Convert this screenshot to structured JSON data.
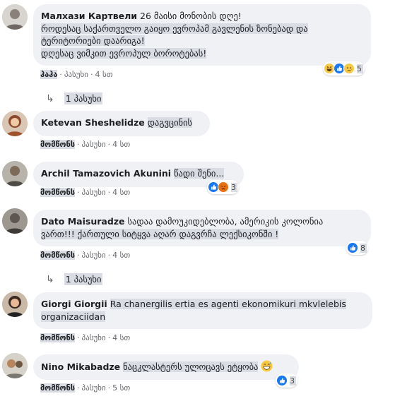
{
  "colors": {
    "bubble": "#eff1f5",
    "highlight": "#d9dde3",
    "like_blue": "#1877f2",
    "haha_yellow": "#f7c940",
    "angry_orange": "#e9710f",
    "meta_gray": "#65676b"
  },
  "comments": [
    {
      "author": "Малхази Картвели",
      "text_lines": [
        "26 მაისი მონობის დღე!",
        "როდესაც საქართველო გაიყო ევროპამ გავლენის ზონებად და",
        "ტერიტორიები დაარიგა!",
        "დღესაც ვიმკით ევროპულ ბოროტებას!"
      ],
      "actions": {
        "like": "ჰაჰა",
        "reply": "პასუხი",
        "time": "4 სთ"
      },
      "reaction_icons": [
        "haha-icon",
        "like-icon",
        "sad-icon"
      ],
      "reaction_count": "5",
      "replies": "1 პასუხი"
    },
    {
      "author": "Ketevan Sheshelidze",
      "text_lines": [
        "დაგვცინის"
      ],
      "actions": {
        "like": "მომწონს",
        "reply": "პასუხი",
        "time": "4 სთ"
      }
    },
    {
      "author": "Archil Tamazovich Akunini",
      "text_lines": [
        "წადი შენი..."
      ],
      "actions": {
        "like": "მომწონს",
        "reply": "პასუხი",
        "time": "4 სთ"
      },
      "reaction_icons": [
        "like-icon",
        "angry-icon"
      ],
      "reaction_count": "3"
    },
    {
      "author": "Dato Maisuradze",
      "text_lines": [
        "სადაა დამოუკიდებლობა, ამერიკის კოლონია",
        "ვართ!!! ქართული სიტყვა აღარ დაგვრჩა ლექსიკონში !"
      ],
      "actions": {
        "like": "მომწონს",
        "reply": "პასუხი",
        "time": "4 სთ"
      },
      "reaction_icons": [
        "like-icon"
      ],
      "reaction_count": "8",
      "replies": "1 პასუხი"
    },
    {
      "author": "Giorgi Giorgii",
      "text_lines": [
        "Ra chanergilis ertia es agenti ekonomikuri mkvlelebis",
        "organizaciidan"
      ],
      "actions": {
        "like": "მომწონს",
        "reply": "პასუხი",
        "time": "4 სთ"
      }
    },
    {
      "author": "Nino Mikabadze",
      "text_lines": [
        "ნაცკლასტერს ულოცავს ეტყობა"
      ],
      "inline_emoji": "grinning-sweat-icon",
      "actions": {
        "like": "მომწონს",
        "reply": "პასუხი",
        "time": "5 სთ"
      },
      "reaction_icons": [
        "like-icon"
      ],
      "reaction_count": "3"
    }
  ]
}
